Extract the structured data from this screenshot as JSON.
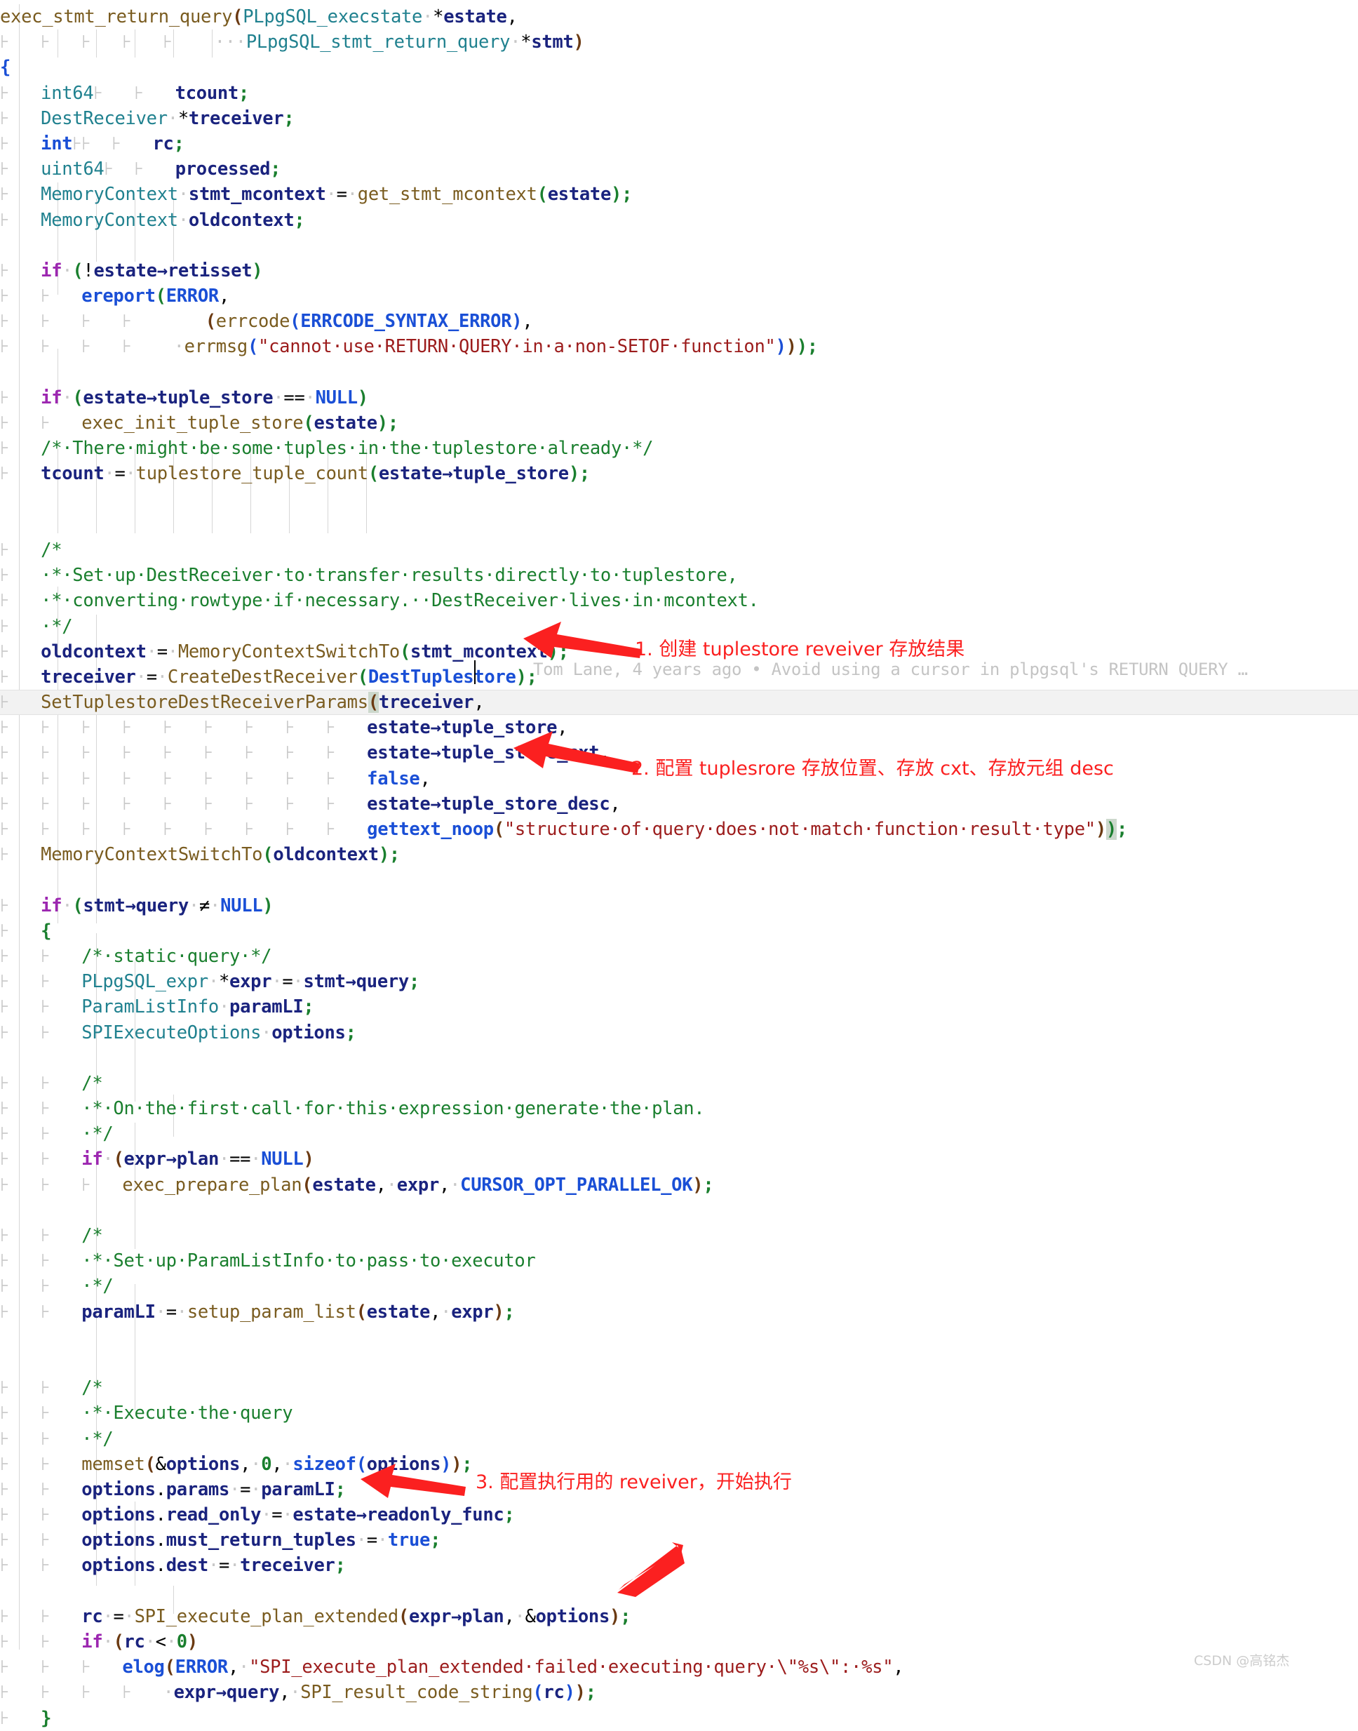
{
  "editor": {
    "language": "c",
    "background": "#ffffff",
    "current_line_highlight": "#f2f2f2",
    "colors": {
      "keyword": "#9c27b0",
      "type": "#20818f",
      "function": "#7a5c20",
      "identifier": "#1a237e",
      "macro": "#1a4fd6",
      "string": "#9c1c1c",
      "comment": "#1a7f2e",
      "annotation_red": "#fb2020",
      "blame_gray": "#c4c4c4"
    },
    "code_lines": [
      "exec_stmt_return_query(PLpgSQL_execstate *estate,",
      "                       PLpgSQL_stmt_return_query *stmt)",
      "{",
      "    int64       tcount;",
      "    DestReceiver *treceiver;",
      "    int         rc;",
      "    uint64      processed;",
      "    MemoryContext stmt_mcontext = get_stmt_mcontext(estate);",
      "    MemoryContext oldcontext;",
      "",
      "    if (!estate->retisset)",
      "        ereport(ERROR,",
      "                (errcode(ERRCODE_SYNTAX_ERROR),",
      "                 errmsg(\"cannot use RETURN QUERY in a non-SETOF function\")));",
      "",
      "    if (estate->tuple_store == NULL)",
      "        exec_init_tuple_store(estate);",
      "    /* There might be some tuples in the tuplestore already */",
      "    tcount = tuplestore_tuple_count(estate->tuple_store);",
      "",
      "    /*",
      "     * Set up DestReceiver to transfer results directly to tuplestore,",
      "     * converting rowtype if necessary.  DestReceiver lives in mcontext.",
      "     */",
      "    oldcontext = MemoryContextSwitchTo(stmt_mcontext);",
      "    treceiver = CreateDestReceiver(DestTuplestore);",
      "    SetTuplestoreDestReceiverParams(treceiver,",
      "                                    estate->tuple_store,",
      "                                    estate->tuple_store_cxt,",
      "                                    false,",
      "                                    estate->tuple_store_desc,",
      "                                    gettext_noop(\"structure of query does not match function result type\"));",
      "    MemoryContextSwitchTo(oldcontext);",
      "",
      "    if (stmt->query != NULL)",
      "    {",
      "        /* static query */",
      "        PLpgSQL_expr *expr = stmt->query;",
      "        ParamListInfo paramLI;",
      "        SPIExecuteOptions options;",
      "",
      "        /*",
      "         * On the first call for this expression generate the plan.",
      "         */",
      "        if (expr->plan == NULL)",
      "            exec_prepare_plan(estate, expr, CURSOR_OPT_PARALLEL_OK);",
      "",
      "        /*",
      "         * Set up ParamListInfo to pass to executor",
      "         */",
      "        paramLI = setup_param_list(estate, expr);",
      "",
      "        /*",
      "         * Execute the query",
      "         */",
      "        memset(&options, 0, sizeof(options));",
      "        options.params = paramLI;",
      "        options.read_only = estate->readonly_func;",
      "        options.must_return_tuples = true;",
      "        options.dest = treceiver;",
      "",
      "        rc = SPI_execute_plan_extended(expr->plan, &options);",
      "        if (rc < 0)",
      "            elog(ERROR, \"SPI_execute_plan_extended failed executing query \\\"%s\\\": %s\",",
      "                 expr->query, SPI_result_code_string(rc));",
      "    }"
    ],
    "current_line_text": "    SetTuplestoreDestReceiverParams(treceiver,",
    "blame": {
      "text": "Tom Lane, 4 years ago • Avoid using a cursor in plpgsql's RETURN QUERY …",
      "author": "Tom Lane",
      "age": "4 years ago",
      "message": "Avoid using a cursor in plpgsql's RETURN QUERY …"
    }
  },
  "annotations": [
    {
      "id": "annot-1",
      "number": "1.",
      "text": "1. 创建 tuplestore reveiver 存放结果",
      "color": "#fb2020",
      "target_line": "treceiver = CreateDestReceiver(DestTuplestore);"
    },
    {
      "id": "annot-2",
      "number": "2.",
      "text": "2. 配置 tuplesrore 存放位置、存放 cxt、存放元组 desc",
      "color": "#fb2020",
      "target_line": "false,"
    },
    {
      "id": "annot-3",
      "number": "3.",
      "text": "3. 配置执行用的 reveiver，开始执行",
      "color": "#fb2020",
      "target_line": "options.dest = treceiver;"
    }
  ],
  "watermark": {
    "text": "CSDN @高铭杰"
  }
}
